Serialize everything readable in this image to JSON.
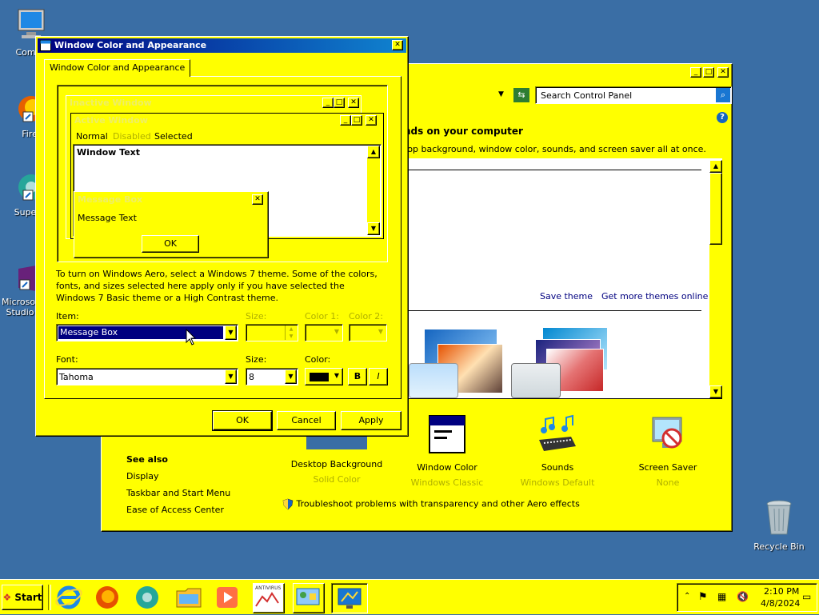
{
  "desktop": {
    "icons": [
      {
        "label": "Compu"
      },
      {
        "label": "Firef"
      },
      {
        "label": "Superm"
      },
      {
        "label": "Microsof Studio"
      },
      {
        "label": "Recycle Bin"
      }
    ]
  },
  "control_panel": {
    "search_placeholder": "Search Control Panel",
    "heading": "nds on your computer",
    "subheading": "top background, window color, sounds, and screen saver all at once.",
    "links": {
      "save_theme": "Save theme",
      "get_more": "Get more themes online"
    },
    "see_also": {
      "title": "See also",
      "items": [
        "Display",
        "Taskbar and Start Menu",
        "Ease of Access Center"
      ]
    },
    "bottom_items": [
      {
        "title": "Desktop Background",
        "value": "Solid Color"
      },
      {
        "title": "Window Color",
        "value": "Windows Classic"
      },
      {
        "title": "Sounds",
        "value": "Windows Default"
      },
      {
        "title": "Screen Saver",
        "value": "None"
      }
    ],
    "troubleshoot": "Troubleshoot problems with transparency and other Aero effects"
  },
  "dialog": {
    "title": "Window Color and Appearance",
    "tab": "Window Color and Appearance",
    "preview": {
      "inactive_title": "Inactive Window",
      "active_title": "Active Window",
      "menu": [
        "Normal",
        "Disabled",
        "Selected"
      ],
      "window_text": "Window Text",
      "msgbox_title": "Message Box",
      "msgbox_text": "Message Text",
      "msgbox_ok": "OK"
    },
    "description": "To turn on Windows Aero, select a Windows 7 theme.  Some of the colors, fonts, and sizes selected here apply only if you have selected the Windows 7 Basic theme or a High Contrast theme.",
    "labels": {
      "item": "Item:",
      "size": "Size:",
      "color1": "Color 1:",
      "color2": "Color 2:",
      "font": "Font:",
      "size2": "Size:",
      "color": "Color:"
    },
    "item_value": "Message Box",
    "font_value": "Tahoma",
    "font_size_value": "8",
    "font_color": "#000000",
    "bold": "B",
    "italic": "I",
    "buttons": {
      "ok": "OK",
      "cancel": "Cancel",
      "apply": "Apply"
    }
  },
  "taskbar": {
    "start": "Start",
    "time": "2:10 PM",
    "date": "4/8/2024",
    "antivirus_label": "ANTIVIRUS"
  },
  "colors": {
    "desktop": "#3a6ea5",
    "theme_yellow": "#ffff00",
    "selection": "#000080",
    "title_bar_start": "#000080",
    "title_bar_end": "#1084d0"
  }
}
